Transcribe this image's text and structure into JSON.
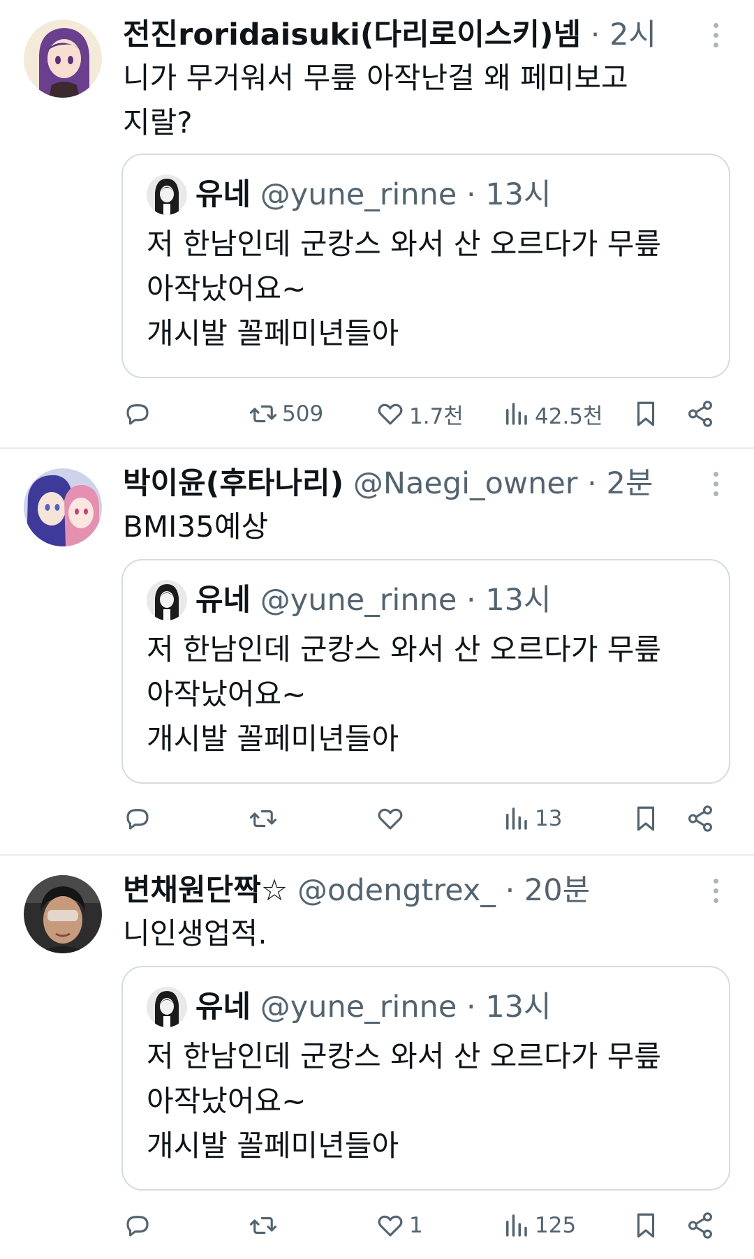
{
  "tweets": [
    {
      "name": "전진roridaisuki(다리로이스키)넴",
      "handle": "",
      "dot": "·",
      "time": "2시",
      "text": "니가 무거워서 무릎 아작난걸 왜 페미보고\n지랄?",
      "quote": {
        "name": "유네",
        "handle": "@yune_rinne",
        "dot": "·",
        "time": "13시",
        "text": "저 한남인데 군캉스 와서 산 오르다가 무릎\n아작났어요~\n개시발 꼴페미년들아"
      },
      "stats": {
        "retweets": "509",
        "likes": "1.7천",
        "views": "42.5천"
      }
    },
    {
      "name": "박이윤(후타나리)",
      "handle": "@Naegi_owner",
      "dot": "·",
      "time": "2분",
      "text": "BMI35예상",
      "quote": {
        "name": "유네",
        "handle": "@yune_rinne",
        "dot": "·",
        "time": "13시",
        "text": "저 한남인데 군캉스 와서 산 오르다가 무릎\n아작났어요~\n개시발 꼴페미년들아"
      },
      "stats": {
        "retweets": "",
        "likes": "",
        "views": "13"
      }
    },
    {
      "name": "변채원단짝☆",
      "handle": "@odengtrex_",
      "dot": "·",
      "time": "20분",
      "text": "니인생업적.",
      "quote": {
        "name": "유네",
        "handle": "@yune_rinne",
        "dot": "·",
        "time": "13시",
        "text": "저 한남인데 군캉스 와서 산 오르다가 무릎\n아작났어요~\n개시발 꼴페미년들아"
      },
      "stats": {
        "retweets": "",
        "likes": "1",
        "views": "125"
      }
    }
  ],
  "icons": {
    "reply": "reply-icon",
    "retweet": "retweet-icon",
    "like": "heart-icon",
    "views": "views-icon",
    "bookmark": "bookmark-icon",
    "share": "share-icon",
    "more": "more-icon"
  },
  "colors": {
    "text": "#0f1419",
    "secondary": "#536471",
    "border": "#d4dce2",
    "separator": "#e8ebee"
  }
}
